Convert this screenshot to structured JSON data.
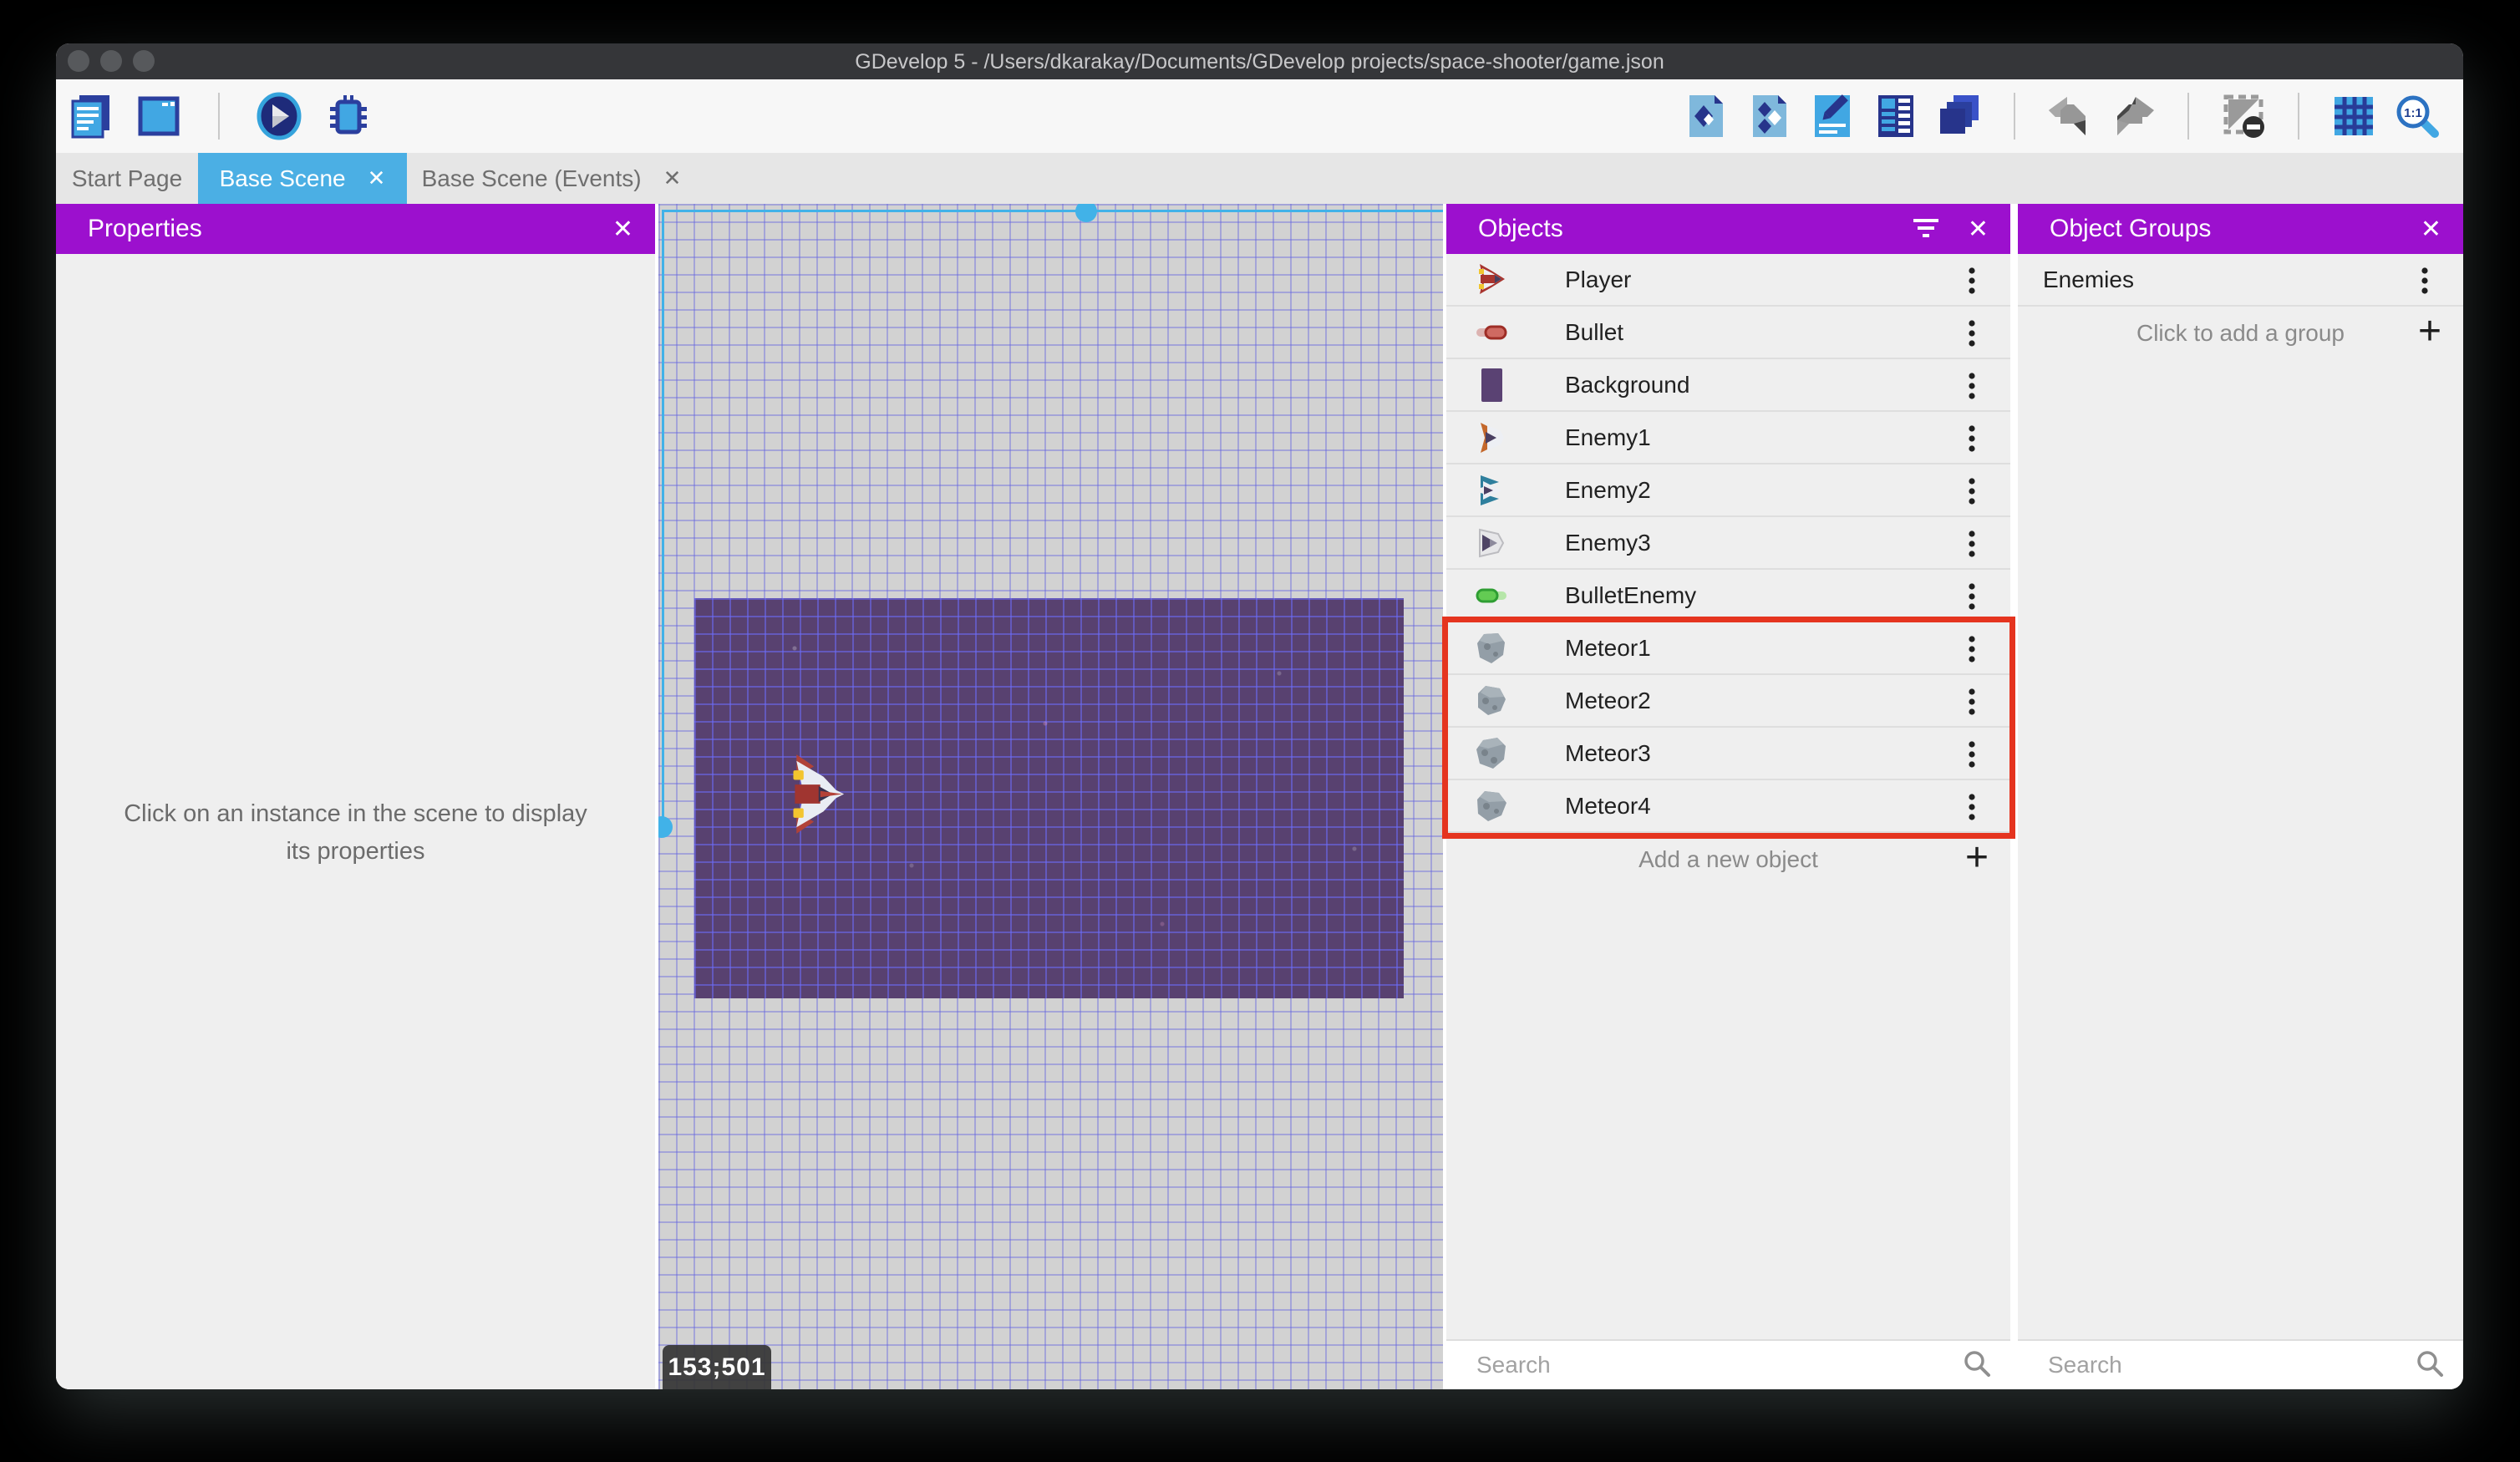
{
  "window": {
    "title": "GDevelop 5 - /Users/dkarakay/Documents/GDevelop projects/space-shooter/game.json",
    "traffic_lights": [
      "close",
      "minimize",
      "zoom"
    ]
  },
  "toolbar": {
    "left_icons": [
      "project-manager-icon",
      "scene-window-icon",
      "preview-play-icon",
      "debug-icon"
    ],
    "right_icons": [
      "objects-panel-icon",
      "object-groups-panel-icon",
      "properties-panel-icon",
      "instances-list-icon",
      "layers-panel-icon",
      "undo-icon",
      "redo-icon",
      "toggle-mask-icon",
      "toggle-grid-icon",
      "zoom-1-1-icon"
    ]
  },
  "tabs": [
    {
      "label": "Start Page",
      "active": false,
      "closable": false
    },
    {
      "label": "Base Scene",
      "active": true,
      "closable": true
    },
    {
      "label": "Base Scene (Events)",
      "active": false,
      "closable": true
    }
  ],
  "properties_panel": {
    "title": "Properties",
    "empty_message": "Click on an instance in the scene to display its properties"
  },
  "scene": {
    "cursor_coordinates": "153;501",
    "selected_instance": "Background"
  },
  "objects_panel": {
    "title": "Objects",
    "items": [
      {
        "name": "Player",
        "icon": "player"
      },
      {
        "name": "Bullet",
        "icon": "bullet"
      },
      {
        "name": "Background",
        "icon": "background"
      },
      {
        "name": "Enemy1",
        "icon": "enemy1"
      },
      {
        "name": "Enemy2",
        "icon": "enemy2"
      },
      {
        "name": "Enemy3",
        "icon": "enemy3"
      },
      {
        "name": "BulletEnemy",
        "icon": "bulletEnemy"
      },
      {
        "name": "Meteor1",
        "icon": "meteor1"
      },
      {
        "name": "Meteor2",
        "icon": "meteor2"
      },
      {
        "name": "Meteor3",
        "icon": "meteor3"
      },
      {
        "name": "Meteor4",
        "icon": "meteor4"
      }
    ],
    "highlighted": [
      "Meteor1",
      "Meteor2",
      "Meteor3",
      "Meteor4"
    ],
    "add_label": "Add a new object",
    "search_placeholder": "Search"
  },
  "object_groups_panel": {
    "title": "Object Groups",
    "groups": [
      {
        "name": "Enemies"
      }
    ],
    "add_label": "Click to add a group",
    "search_placeholder": "Search"
  },
  "colors": {
    "header_purple": "#9C10CE",
    "active_tab_cyan": "#4BAFE4",
    "selection_cyan": "#41B2E8",
    "highlight_red": "#E5341F"
  }
}
